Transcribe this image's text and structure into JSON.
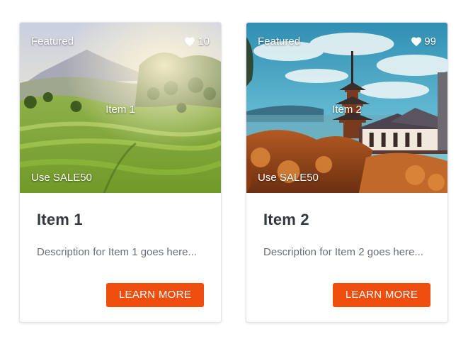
{
  "cards": [
    {
      "badge": "Featured",
      "likes": "10",
      "image_label": "Item 1",
      "promo": "Use SALE50",
      "title": "Item 1",
      "description": "Description for Item 1 goes here...",
      "button_label": "LEARN MORE",
      "image_subject": "rice terraces with volcano"
    },
    {
      "badge": "Featured",
      "likes": "99",
      "image_label": "Item 2",
      "promo": "Use SALE50",
      "title": "Item 2",
      "description": "Description for Item 2 goes here...",
      "button_label": "LEARN MORE",
      "image_subject": "japanese pagoda temple"
    }
  ],
  "colors": {
    "button": "#f04e0f",
    "title": "#333840",
    "description": "#6a6f77"
  },
  "icons": {
    "likes": "heart-icon"
  }
}
